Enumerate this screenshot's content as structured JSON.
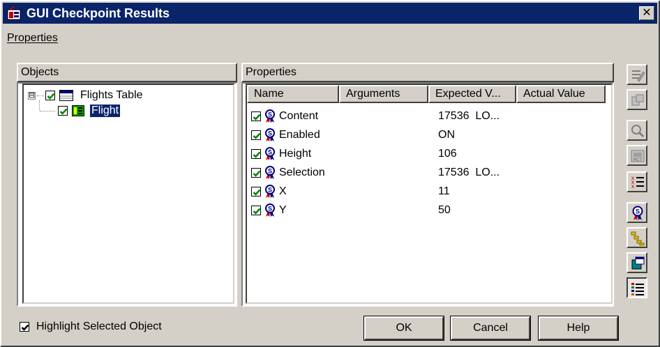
{
  "window": {
    "title": "GUI Checkpoint Results"
  },
  "menu": {
    "properties": "Properties"
  },
  "objects_panel": {
    "header": "Objects",
    "tree": [
      {
        "label": "Flights Table",
        "expander": "⊟",
        "checked": true,
        "icon": "table-icon"
      },
      {
        "label": "Flight",
        "checked": true,
        "icon": "list-object-icon",
        "selected": true
      }
    ]
  },
  "properties_panel": {
    "header": "Properties",
    "columns": [
      "Name",
      "Arguments",
      "Expected V...",
      "Actual Value"
    ],
    "rows": [
      {
        "name": "Content",
        "arguments": "",
        "expected": "17536  LO...",
        "actual": "",
        "checked": true
      },
      {
        "name": "Enabled",
        "arguments": "",
        "expected": "ON",
        "actual": "",
        "checked": true
      },
      {
        "name": "Height",
        "arguments": "",
        "expected": "106",
        "actual": "",
        "checked": true
      },
      {
        "name": "Selection",
        "arguments": "",
        "expected": "17536  LO...",
        "actual": "",
        "checked": true
      },
      {
        "name": "X",
        "arguments": "",
        "expected": "11",
        "actual": "",
        "checked": true
      },
      {
        "name": "Y",
        "arguments": "",
        "expected": "50",
        "actual": "",
        "checked": true
      }
    ]
  },
  "toolbar": {
    "buttons": [
      "edit-expected-icon",
      "compare-icon",
      "zoom-icon",
      "capture-icon",
      "check-list-icon",
      "property-icon",
      "tree-view-icon",
      "window-icon",
      "list-view-icon"
    ]
  },
  "footer": {
    "highlight_label": "Highlight Selected Object",
    "highlight_checked": true,
    "ok": "OK",
    "cancel": "Cancel",
    "help": "Help"
  },
  "colors": {
    "title_bar": "#0a246a",
    "face": "#d4d0c8",
    "selection": "#0a246a"
  }
}
